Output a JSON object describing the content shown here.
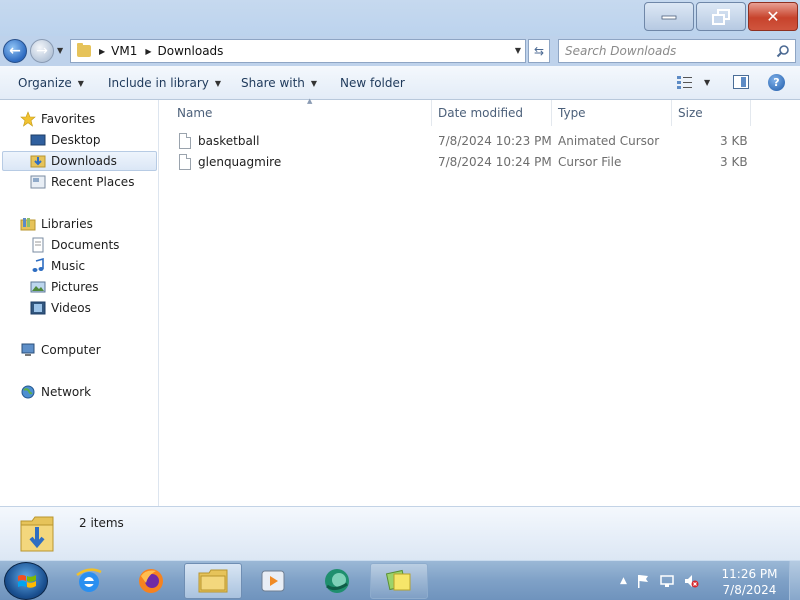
{
  "window": {
    "minimize_label": "",
    "maximize_label": "",
    "close_label": "✕"
  },
  "address": {
    "crumbs": [
      "VM1",
      "Downloads"
    ],
    "search_placeholder": "Search Downloads"
  },
  "toolbar": {
    "organize": "Organize",
    "include_in_library": "Include in library",
    "share_with": "Share with",
    "new_folder": "New folder",
    "help": "?"
  },
  "navigation": {
    "favorites": {
      "label": "Favorites",
      "items": [
        "Desktop",
        "Downloads",
        "Recent Places"
      ],
      "selected": "Downloads"
    },
    "libraries": {
      "label": "Libraries",
      "items": [
        "Documents",
        "Music",
        "Pictures",
        "Videos"
      ]
    },
    "computer": "Computer",
    "network": "Network"
  },
  "columns": [
    "Name",
    "Date modified",
    "Type",
    "Size"
  ],
  "files": [
    {
      "name": "basketball",
      "date_modified": "7/8/2024 10:23 PM",
      "type": "Animated Cursor",
      "size": "3 KB"
    },
    {
      "name": "glenquagmire",
      "date_modified": "7/8/2024 10:24 PM",
      "type": "Cursor File",
      "size": "3 KB"
    }
  ],
  "details": {
    "item_count": "2 items"
  },
  "taskbar": {
    "apps": [
      "internet-explorer",
      "firefox",
      "windows-explorer",
      "media-player",
      "browser",
      "sticky-notes"
    ],
    "active_app": "windows-explorer",
    "time": "11:26 PM",
    "date": "7/8/2024"
  },
  "colors": {
    "accent": "#1e5aa8",
    "selection": "#dbe7f6",
    "close": "#c7432c"
  }
}
